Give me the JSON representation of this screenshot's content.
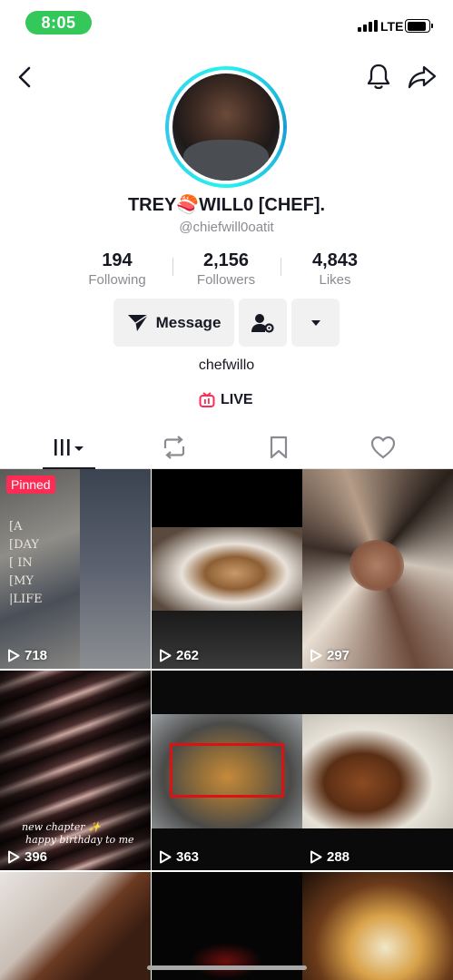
{
  "status_bar": {
    "time": "8:05",
    "network": "LTE"
  },
  "profile": {
    "display_name": "TREY🍣WILL0 [CHEF].",
    "username": "@chiefwill0oatit",
    "bio": "chefwillo",
    "live_label": "LIVE"
  },
  "stats": [
    {
      "value": "194",
      "label": "Following"
    },
    {
      "value": "2,156",
      "label": "Followers"
    },
    {
      "value": "4,843",
      "label": "Likes"
    }
  ],
  "actions": {
    "message_label": "Message"
  },
  "tabs": [
    {
      "icon": "videos-grid-icon",
      "active": true
    },
    {
      "icon": "repost-icon",
      "active": false
    },
    {
      "icon": "bookmark-icon",
      "active": false
    },
    {
      "icon": "liked-heart-icon",
      "active": false
    }
  ],
  "videos": [
    {
      "views": "718",
      "pinned_label": "Pinned",
      "overlay": [
        "[A",
        "[DAY",
        "[ IN",
        "[MY",
        " |LIFE"
      ]
    },
    {
      "views": "262"
    },
    {
      "views": "297"
    },
    {
      "views": "396",
      "caption": [
        "new chapter ✨",
        "happy birthday to me"
      ]
    },
    {
      "views": "363"
    },
    {
      "views": "288"
    },
    {
      "views": ""
    },
    {
      "views": ""
    },
    {
      "views": ""
    }
  ],
  "colors": {
    "accent": "#fe2c55",
    "ring": "#25f4ee",
    "status_green": "#34c759"
  }
}
